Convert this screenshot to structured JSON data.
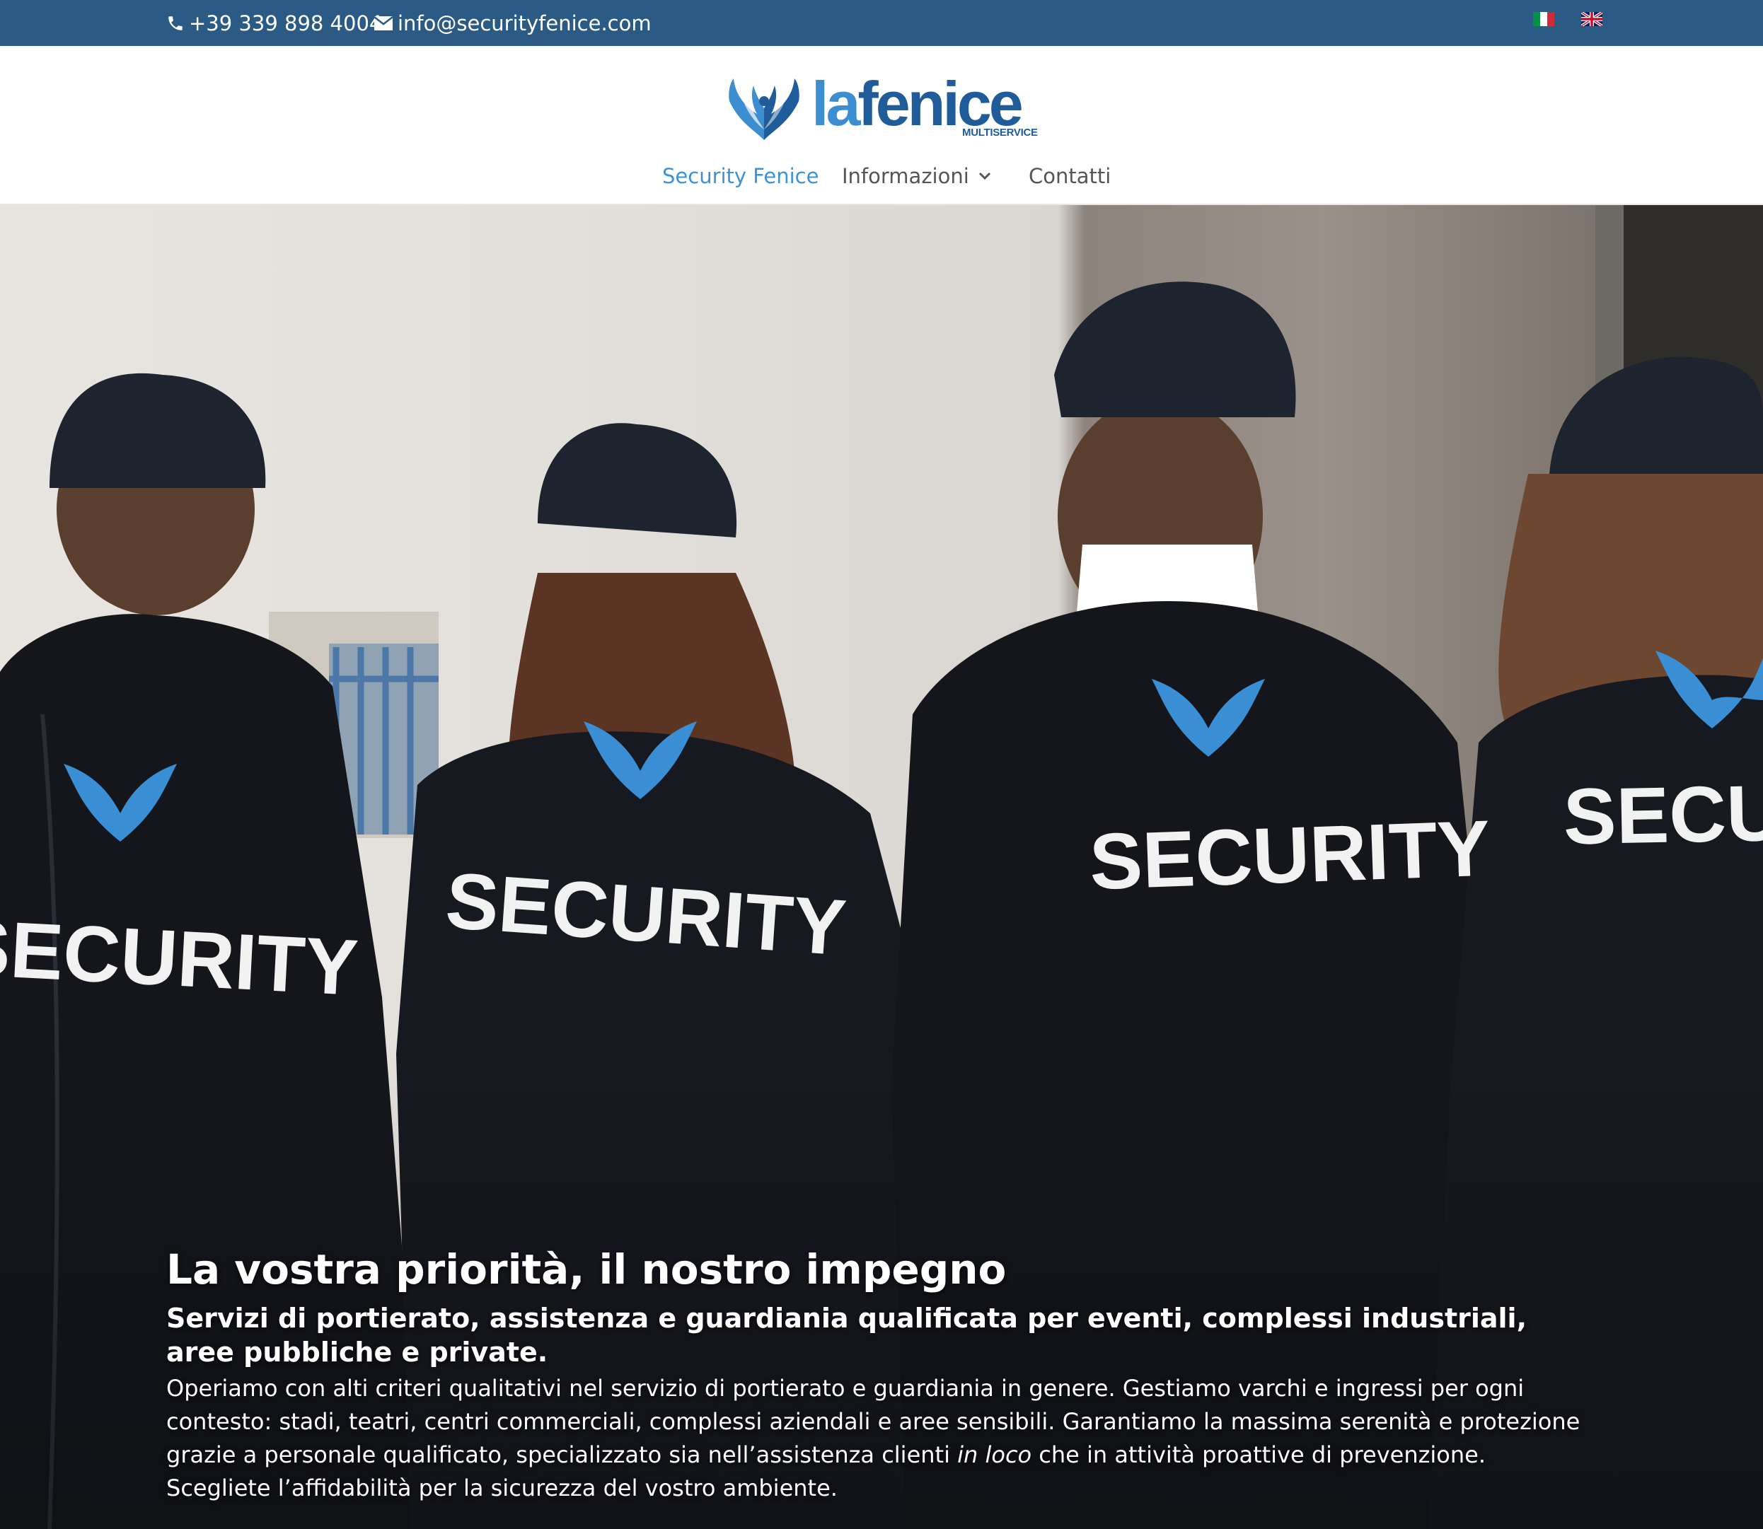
{
  "topbar": {
    "phone": "+39 339 898 4004",
    "email": "info@securityfenice.com",
    "phone_icon": "phone-icon",
    "email_icon": "envelope-icon",
    "languages": [
      {
        "code": "it",
        "icon": "italy-flag-icon"
      },
      {
        "code": "en",
        "icon": "uk-flag-icon"
      }
    ]
  },
  "logo": {
    "word_la": "la",
    "word_fenice": "fenice",
    "subtitle": "MULTISERVICE"
  },
  "nav": {
    "items": [
      {
        "label": "Security Fenice",
        "active": true
      },
      {
        "label": "Informazioni",
        "has_dropdown": true
      },
      {
        "label": "Contatti"
      }
    ]
  },
  "hero": {
    "jacket_text": "SECURITY",
    "title": "La vostra priorità, il nostro impegno",
    "subtitle": "Servizi di portierato, assistenza e guardiania qualificata per eventi, complessi industriali, aree pubbliche e private.",
    "body_before_em": "Operiamo con alti criteri qualitativi nel servizio di portierato e guardiania in genere. Gestiamo varchi e ingressi per ogni contesto: stadi, teatri, centri commerciali, complessi aziendali e aree sensibili. Garantiamo la massima serenità e protezione grazie a personale qualificato, specializzato sia nell’assistenza clienti ",
    "body_em": "in loco",
    "body_after_em": " che in attività proattive di prevenzione. Scegliete l’affidabilità per la sicurezza del vostro ambiente."
  },
  "colors": {
    "topbar_bg": "#2b5a84",
    "nav_active": "#3d93d6",
    "logo_light": "#3c8ed0",
    "logo_dark": "#1f5c99"
  }
}
